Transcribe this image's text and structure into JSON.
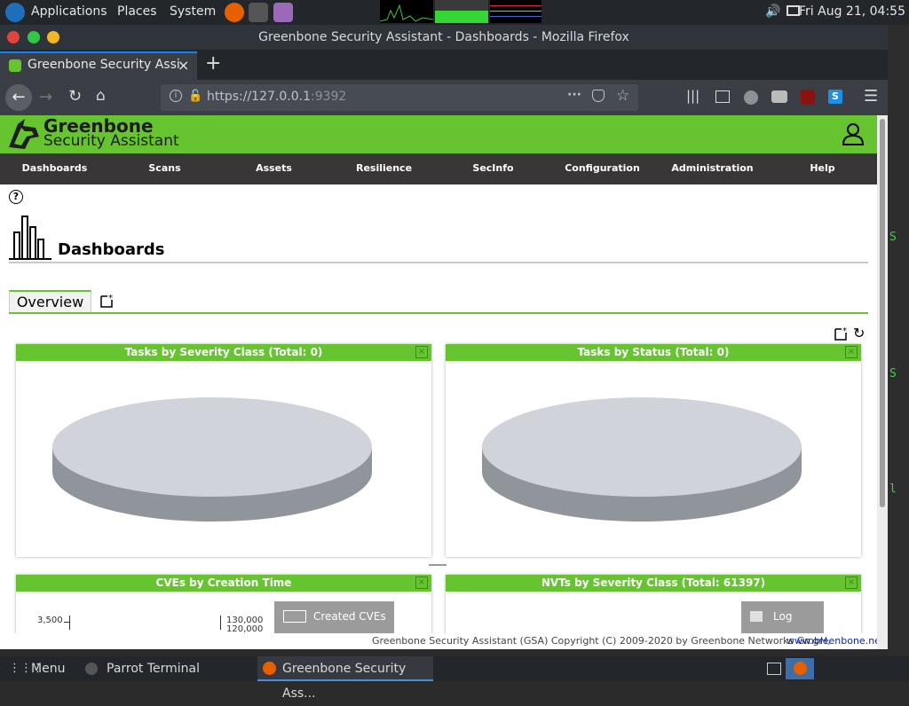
{
  "os_panel": {
    "applications": "Applications",
    "places": "Places",
    "system": "System",
    "clock": "Fri Aug 21, 04:55"
  },
  "firefox": {
    "window_title": "Greenbone Security Assistant - Dashboards - Mozilla Firefox",
    "tab_title": "Greenbone Security Assi",
    "url_host": "https://127.0.0.1",
    "url_port": ":9392"
  },
  "gsa": {
    "logo_line1": "Greenbone",
    "logo_line2": "Security Assistant",
    "menu": [
      "Dashboards",
      "Scans",
      "Assets",
      "Resilience",
      "SecInfo",
      "Configuration",
      "Administration",
      "Help"
    ],
    "page_title": "Dashboards",
    "tab_overview": "Overview",
    "panels": {
      "p1": "Tasks by Severity Class (Total: 0)",
      "p2": "Tasks by Status (Total: 0)",
      "p3": "CVEs by Creation Time",
      "p4": "NVTs by Severity Class (Total: 61397)"
    },
    "cve_chart": {
      "y_left_tick": "3,500",
      "y_right_tick_1": "130,000",
      "y_right_tick_2": "120,000",
      "legend": "Created CVEs"
    },
    "nvt_chart": {
      "legend": "Log"
    },
    "footer_text": "Greenbone Security Assistant (GSA) Copyright (C) 2009-2020 by Greenbone Networks GmbH,",
    "footer_link": "www.greenbone.net"
  },
  "taskbar": {
    "menu": "Menu",
    "terminal": "Parrot Terminal",
    "firefox": "Greenbone Security Ass..."
  },
  "colors": {
    "gsa_green": "#66c430",
    "menu_bg": "#393637",
    "pie_top": "#d0d3d9",
    "pie_side": "#8f959b"
  }
}
